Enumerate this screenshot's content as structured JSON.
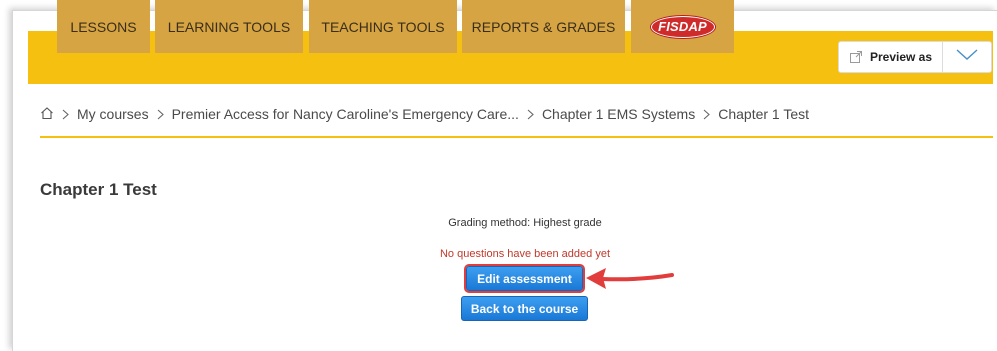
{
  "nav": {
    "tabs": [
      {
        "label": "LESSONS"
      },
      {
        "label": "LEARNING TOOLS"
      },
      {
        "label": "TEACHING TOOLS"
      },
      {
        "label": "REPORTS & GRADES"
      }
    ],
    "logo_text": "FISDAP",
    "preview_label": "Preview as"
  },
  "breadcrumb": {
    "items": [
      "My courses",
      "Premier Access for Nancy Caroline's Emergency Care...",
      "Chapter 1 EMS Systems",
      "Chapter 1 Test"
    ]
  },
  "page": {
    "title": "Chapter 1 Test",
    "grading_method": "Grading method: Highest grade",
    "notice": "No questions have been added yet",
    "edit_button": "Edit assessment",
    "back_button": "Back to the course"
  },
  "colors": {
    "nav_bar": "#f5c010",
    "nav_tab": "#d6a442",
    "notice": "#c0392b",
    "button": "#1a78d6",
    "highlight": "#e23d3d"
  }
}
